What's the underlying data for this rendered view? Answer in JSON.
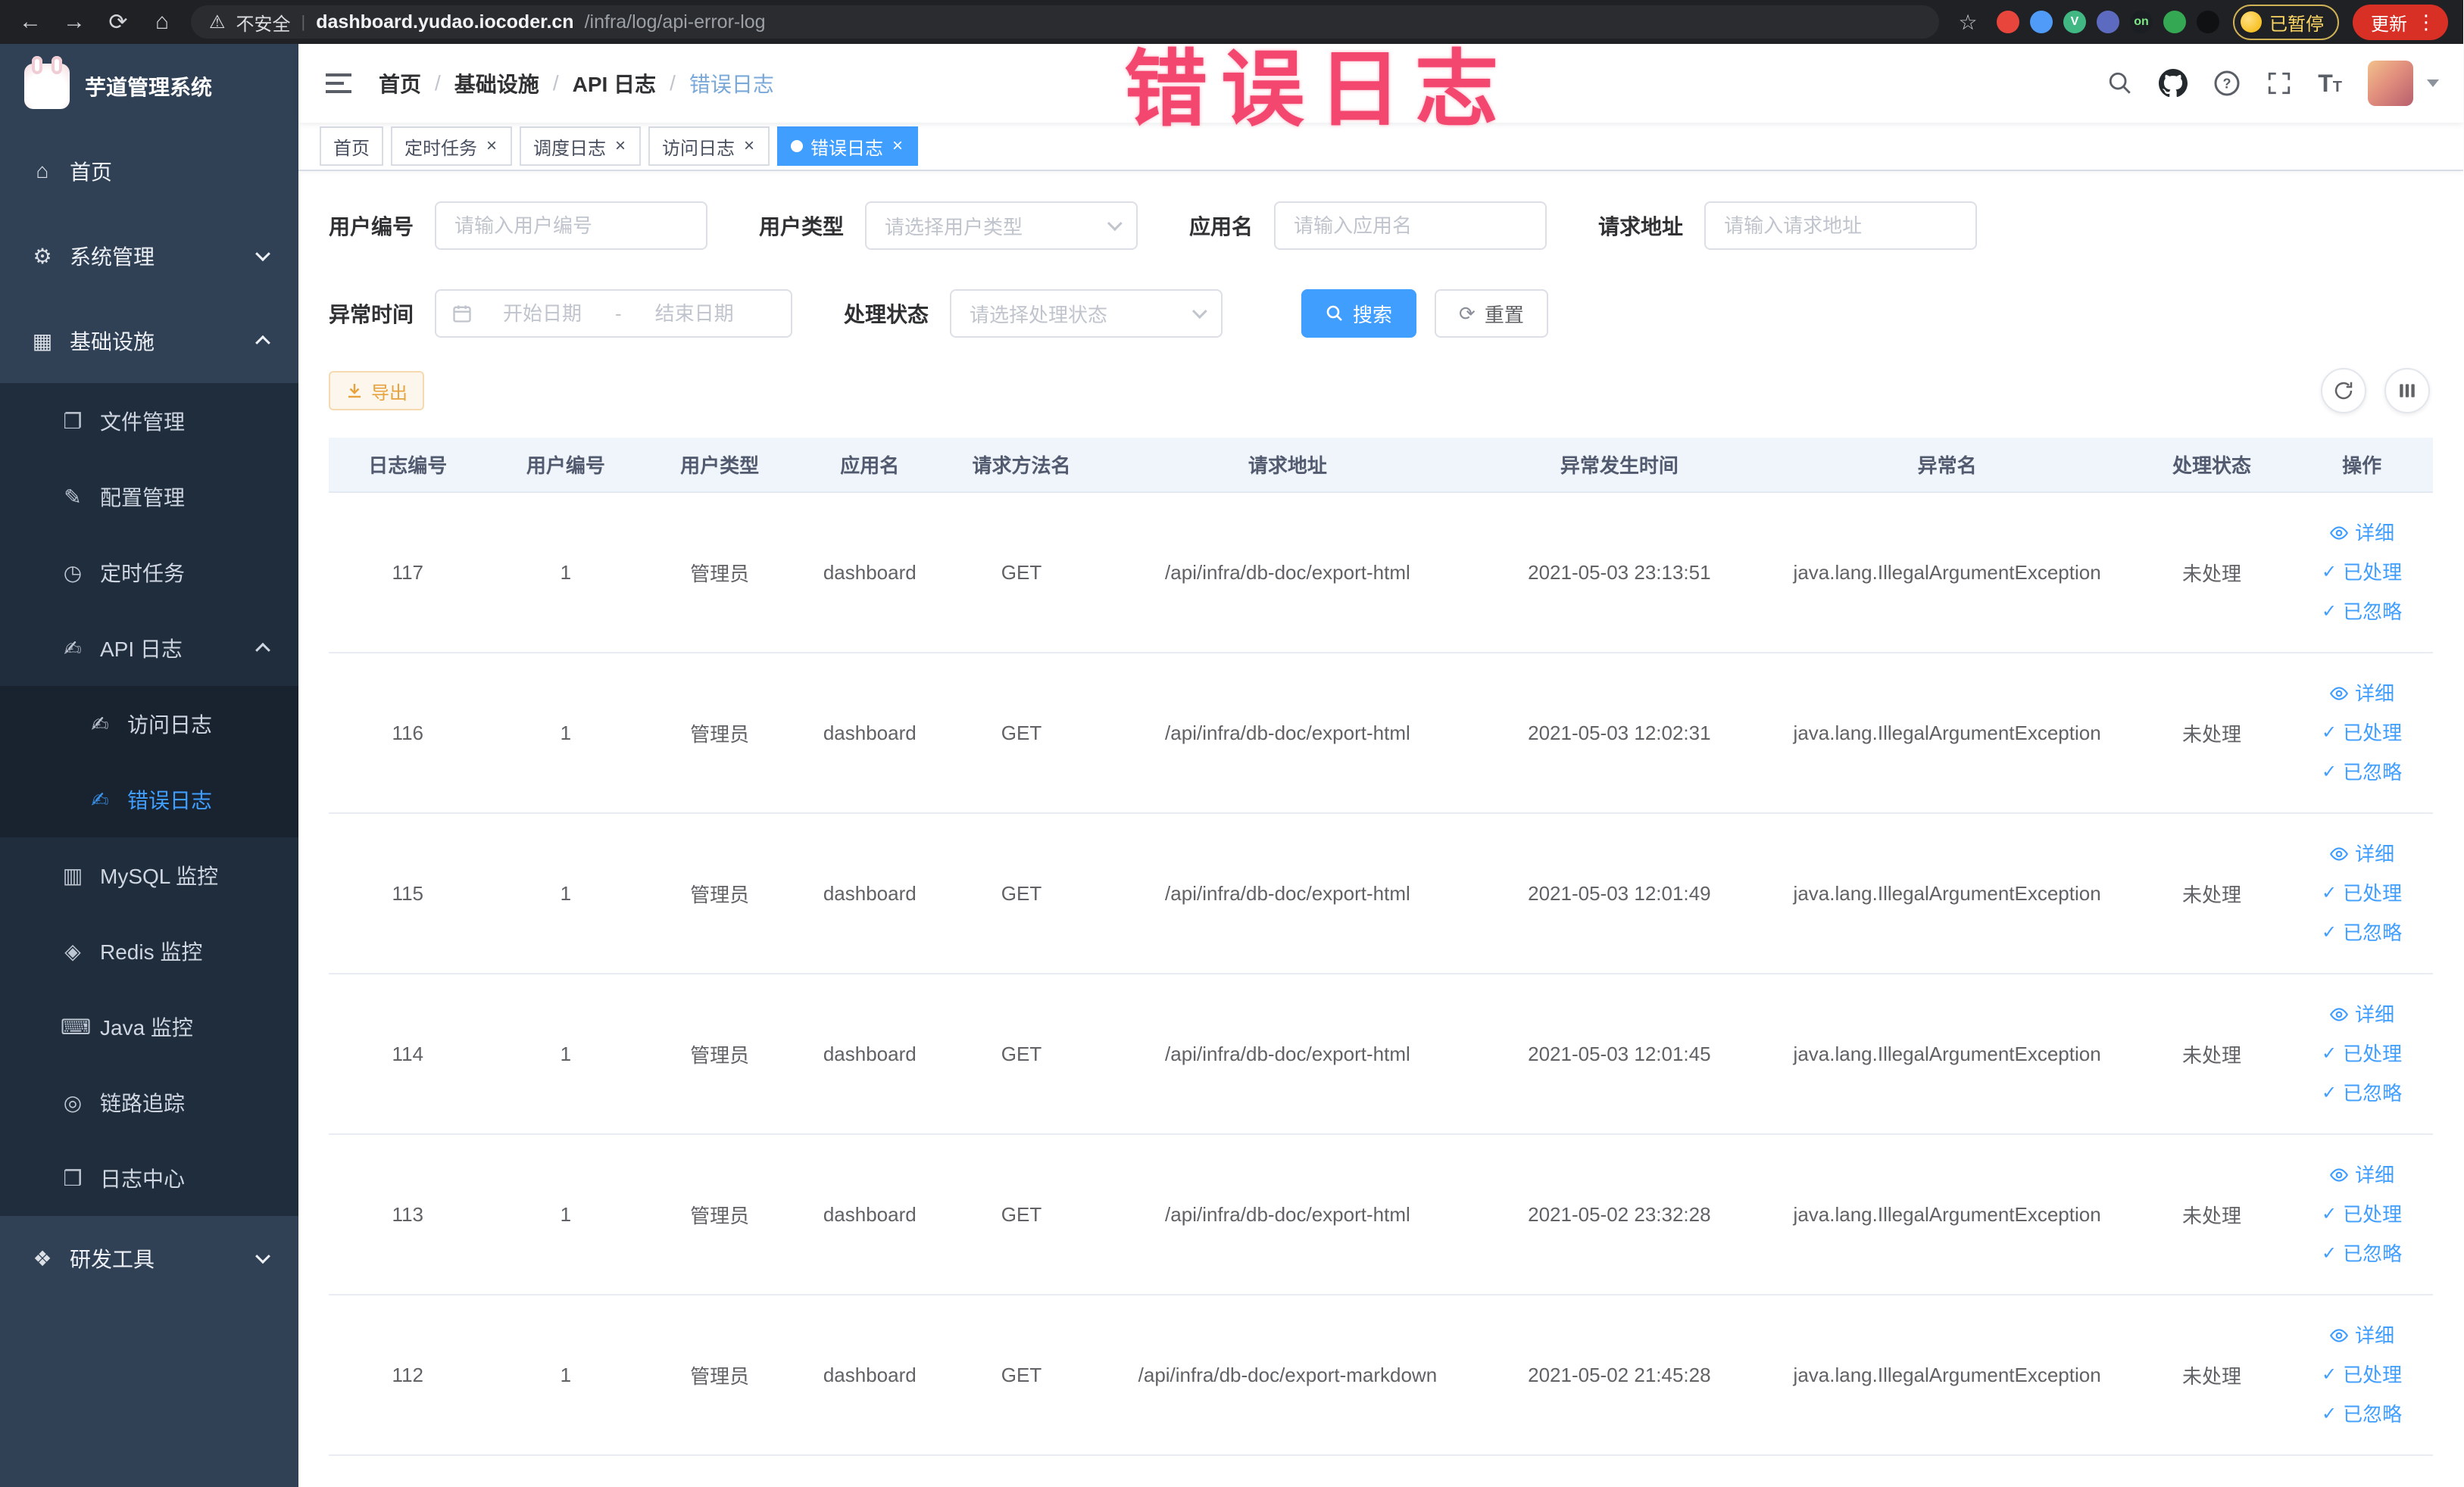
{
  "colors": {
    "accent": "#409eff",
    "sidebar_bg": "#304156",
    "submenu_bg": "#1f2d3d",
    "table_header_bg": "#f0f5fb",
    "warning": "#e6a23c",
    "annotation": "#f3476f",
    "update_badge": "#d93025",
    "paused_badge": "#fdd663"
  },
  "annotation": {
    "text": "错误日志"
  },
  "browser": {
    "security_label": "不安全",
    "url_domain": "dashboard.yudao.iocoder.cn",
    "url_path": "/infra/log/api-error-log",
    "paused_badge": "已暂停",
    "update_label": "更新",
    "extensions": [
      {
        "name": "extension-dot-red",
        "color": "#e8453c"
      },
      {
        "name": "extension-dot-blue",
        "color": "#4f9bf7"
      },
      {
        "name": "extension-vue-devtools",
        "color": "#41b883",
        "text": "V"
      },
      {
        "name": "extension-dot-indigo",
        "color": "#5c6bc0"
      },
      {
        "name": "extension-on-badge",
        "color": "#1b1f23",
        "text": "on",
        "text_color": "#7ee787"
      },
      {
        "name": "extension-dot-green",
        "color": "#34a853"
      },
      {
        "name": "extension-pin",
        "color": "#101113"
      }
    ]
  },
  "sidebar": {
    "logo_title": "芋道管理系统",
    "menu": [
      {
        "label": "首页",
        "icon": "home",
        "level": 1
      },
      {
        "label": "系统管理",
        "icon": "gear",
        "level": 1,
        "expand": "down"
      },
      {
        "label": "基础设施",
        "icon": "infra",
        "level": 1,
        "expand": "up"
      },
      {
        "label": "文件管理",
        "icon": "file",
        "level": 2
      },
      {
        "label": "配置管理",
        "icon": "config",
        "level": 2
      },
      {
        "label": "定时任务",
        "icon": "job",
        "level": 2
      },
      {
        "label": "API 日志",
        "icon": "apilog",
        "level": 2,
        "expand": "up"
      },
      {
        "label": "访问日志",
        "icon": "accesslog",
        "level": 3
      },
      {
        "label": "错误日志",
        "icon": "errorlog",
        "level": 3,
        "active": true
      },
      {
        "label": "MySQL 监控",
        "icon": "mysql",
        "level": 2
      },
      {
        "label": "Redis 监控",
        "icon": "redis",
        "level": 2
      },
      {
        "label": "Java 监控",
        "icon": "java",
        "level": 2
      },
      {
        "label": "链路追踪",
        "icon": "trace",
        "level": 2
      },
      {
        "label": "日志中心",
        "icon": "logcenter",
        "level": 2
      },
      {
        "label": "研发工具",
        "icon": "tools",
        "level": 1,
        "expand": "down"
      }
    ]
  },
  "navbar": {
    "breadcrumb": [
      "首页",
      "基础设施",
      "API 日志",
      "错误日志"
    ]
  },
  "tabs": [
    {
      "label": "首页",
      "closable": false,
      "active": false
    },
    {
      "label": "定时任务",
      "closable": true,
      "active": false
    },
    {
      "label": "调度日志",
      "closable": true,
      "active": false
    },
    {
      "label": "访问日志",
      "closable": true,
      "active": false
    },
    {
      "label": "错误日志",
      "closable": true,
      "active": true
    }
  ],
  "filters": {
    "user_id": {
      "label": "用户编号",
      "placeholder": "请输入用户编号"
    },
    "user_type": {
      "label": "用户类型",
      "placeholder": "请选择用户类型"
    },
    "app_name": {
      "label": "应用名",
      "placeholder": "请输入应用名"
    },
    "request_url": {
      "label": "请求地址",
      "placeholder": "请输入请求地址"
    },
    "exception_time": {
      "label": "异常时间",
      "start_placeholder": "开始日期",
      "separator": "-",
      "end_placeholder": "结束日期"
    },
    "process_status": {
      "label": "处理状态",
      "placeholder": "请选择处理状态"
    },
    "search_label": "搜索",
    "reset_label": "重置"
  },
  "toolbar": {
    "export_label": "导出"
  },
  "table": {
    "columns": [
      "日志编号",
      "用户编号",
      "用户类型",
      "应用名",
      "请求方法名",
      "请求地址",
      "异常发生时间",
      "异常名",
      "处理状态",
      "操作"
    ],
    "actions": [
      "详细",
      "已处理",
      "已忽略"
    ],
    "rows": [
      {
        "id": "117",
        "user_id": "1",
        "user_type": "管理员",
        "app": "dashboard",
        "method": "GET",
        "url": "/api/infra/db-doc/export-html",
        "time": "2021-05-03 23:13:51",
        "exception": "java.lang.IllegalArgumentException",
        "status": "未处理"
      },
      {
        "id": "116",
        "user_id": "1",
        "user_type": "管理员",
        "app": "dashboard",
        "method": "GET",
        "url": "/api/infra/db-doc/export-html",
        "time": "2021-05-03 12:02:31",
        "exception": "java.lang.IllegalArgumentException",
        "status": "未处理"
      },
      {
        "id": "115",
        "user_id": "1",
        "user_type": "管理员",
        "app": "dashboard",
        "method": "GET",
        "url": "/api/infra/db-doc/export-html",
        "time": "2021-05-03 12:01:49",
        "exception": "java.lang.IllegalArgumentException",
        "status": "未处理"
      },
      {
        "id": "114",
        "user_id": "1",
        "user_type": "管理员",
        "app": "dashboard",
        "method": "GET",
        "url": "/api/infra/db-doc/export-html",
        "time": "2021-05-03 12:01:45",
        "exception": "java.lang.IllegalArgumentException",
        "status": "未处理"
      },
      {
        "id": "113",
        "user_id": "1",
        "user_type": "管理员",
        "app": "dashboard",
        "method": "GET",
        "url": "/api/infra/db-doc/export-html",
        "time": "2021-05-02 23:32:28",
        "exception": "java.lang.IllegalArgumentException",
        "status": "未处理"
      },
      {
        "id": "112",
        "user_id": "1",
        "user_type": "管理员",
        "app": "dashboard",
        "method": "GET",
        "url": "/api/infra/db-doc/export-markdown",
        "time": "2021-05-02 21:45:28",
        "exception": "java.lang.IllegalArgumentException",
        "status": "未处理"
      }
    ]
  }
}
